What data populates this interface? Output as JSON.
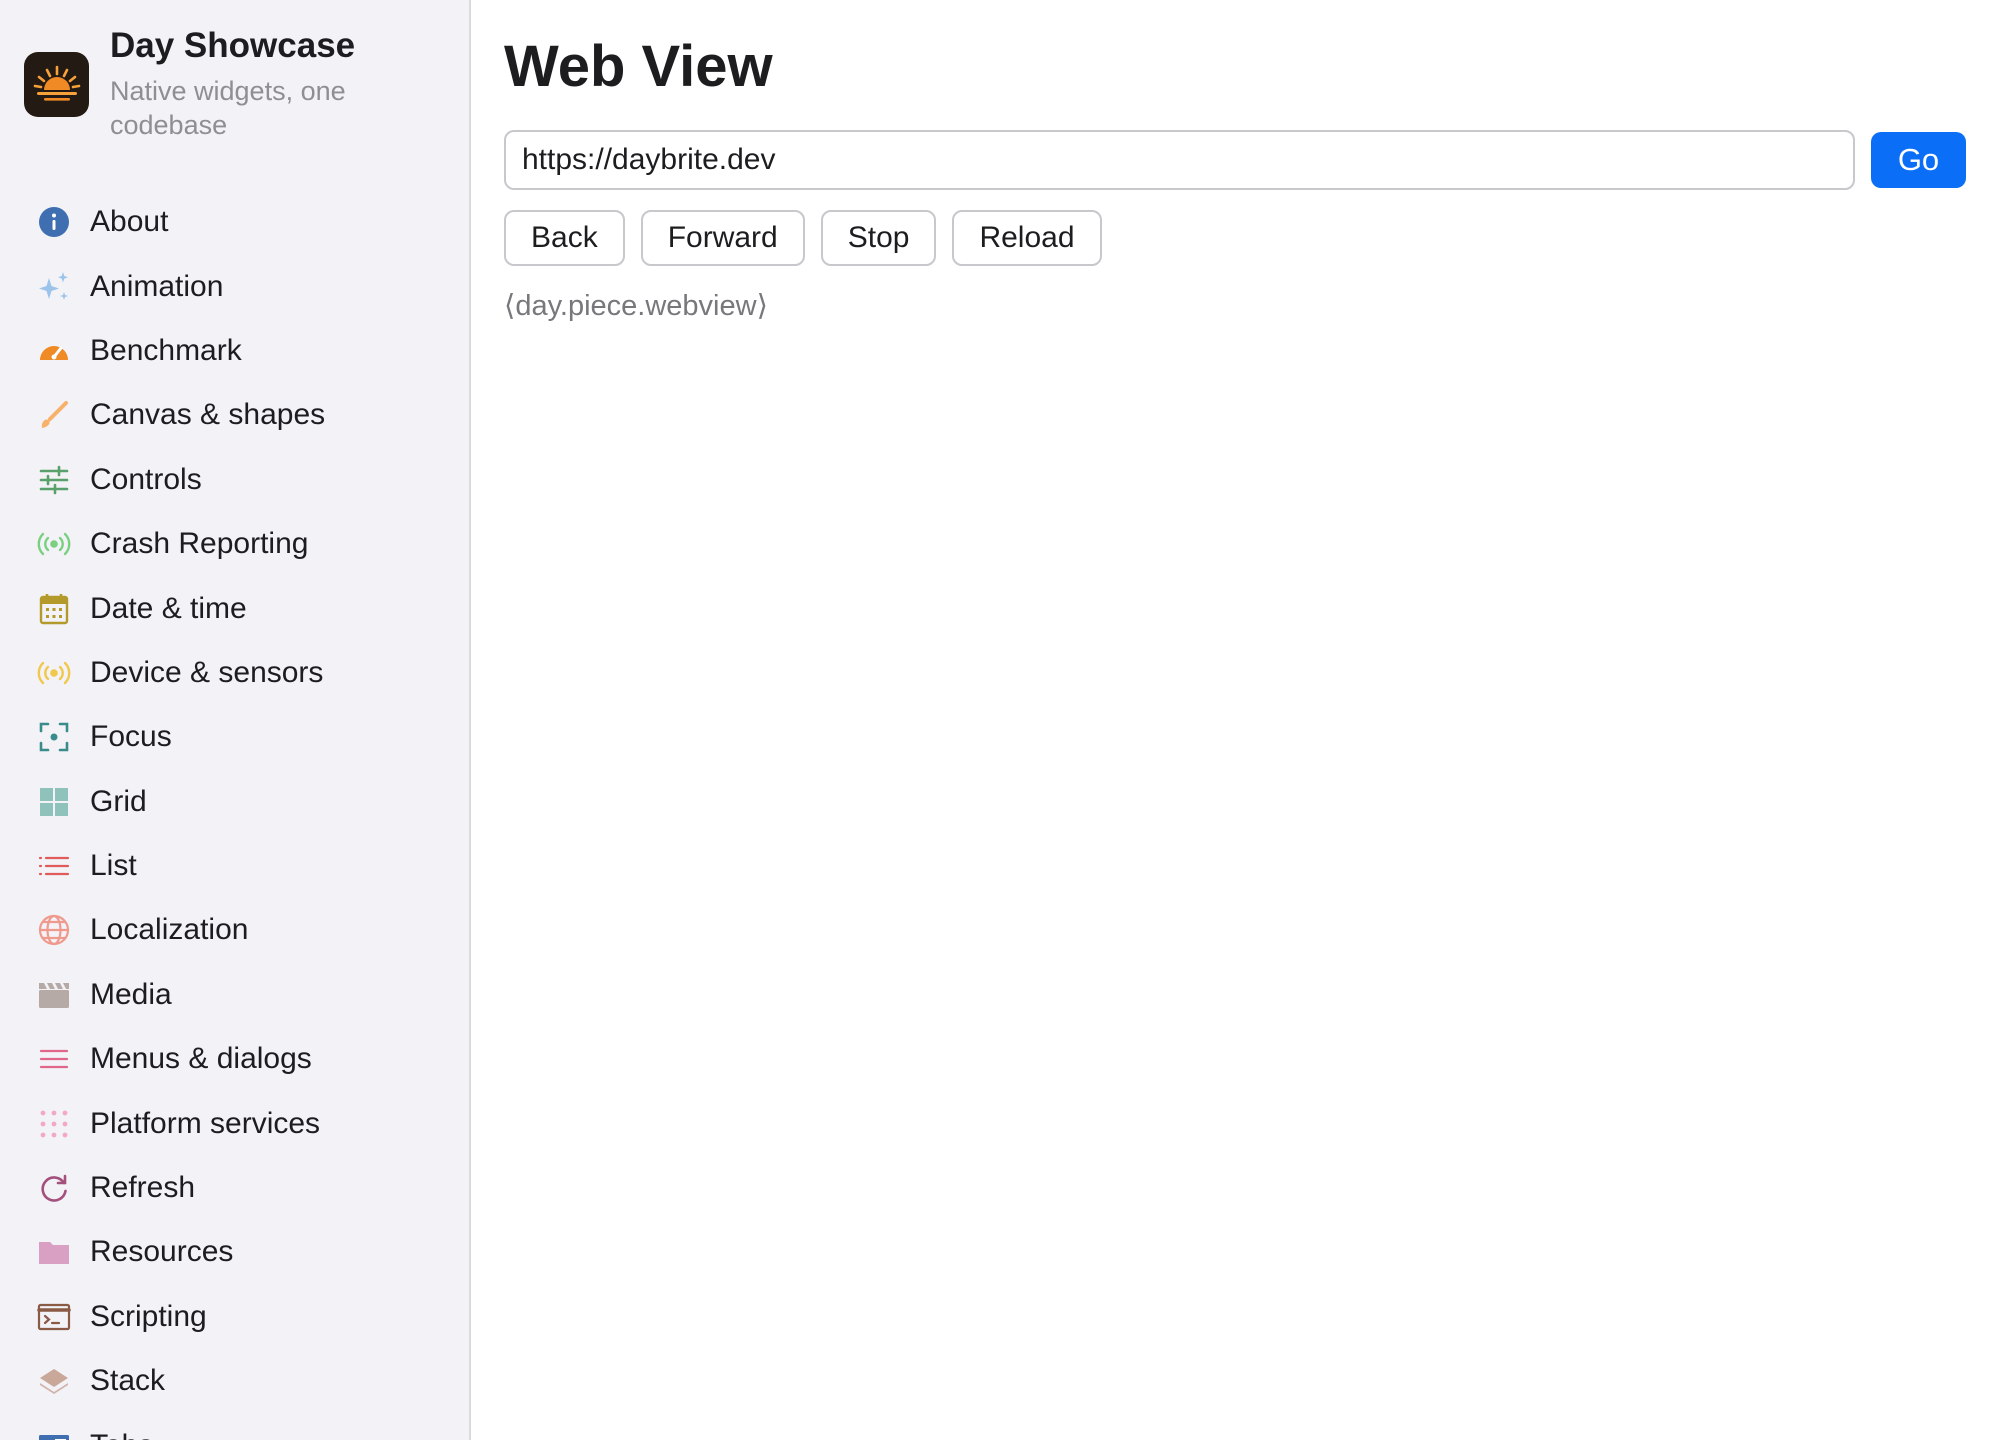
{
  "brand": {
    "title": "Day Showcase",
    "subtitle": "Native widgets, one codebase",
    "logo_icon": "sunrise-logo-icon"
  },
  "sidebar": {
    "items": [
      {
        "label": "About",
        "icon": "info-icon",
        "color": "#3f6fb0"
      },
      {
        "label": "Animation",
        "icon": "sparkles-icon",
        "color": "#9cc4ea"
      },
      {
        "label": "Benchmark",
        "icon": "speedometer-icon",
        "color": "#f08a24"
      },
      {
        "label": "Canvas & shapes",
        "icon": "paintbrush-icon",
        "color": "#f7b16a"
      },
      {
        "label": "Controls",
        "icon": "sliders-icon",
        "color": "#5aa06a"
      },
      {
        "label": "Crash Reporting",
        "icon": "broadcast-icon",
        "color": "#7bd080"
      },
      {
        "label": "Date & time",
        "icon": "calendar-icon",
        "color": "#b39a2a"
      },
      {
        "label": "Device & sensors",
        "icon": "broadcast-icon",
        "color": "#f2c84a"
      },
      {
        "label": "Focus",
        "icon": "focus-icon",
        "color": "#3a8c8c"
      },
      {
        "label": "Grid",
        "icon": "grid-icon",
        "color": "#8fc2bb"
      },
      {
        "label": "List",
        "icon": "list-icon",
        "color": "#e25b5b"
      },
      {
        "label": "Localization",
        "icon": "globe-icon",
        "color": "#f09a8e"
      },
      {
        "label": "Media",
        "icon": "film-icon",
        "color": "#b5aaa6"
      },
      {
        "label": "Menus & dialogs",
        "icon": "menu-icon",
        "color": "#e0678a"
      },
      {
        "label": "Platform services",
        "icon": "dots-grid-icon",
        "color": "#f4a9c2"
      },
      {
        "label": "Refresh",
        "icon": "refresh-icon",
        "color": "#a3507c"
      },
      {
        "label": "Resources",
        "icon": "folder-icon",
        "color": "#d9a0c4"
      },
      {
        "label": "Scripting",
        "icon": "terminal-icon",
        "color": "#8a5a45"
      },
      {
        "label": "Stack",
        "icon": "layers-icon",
        "color": "#c9a89a"
      },
      {
        "label": "Tabs",
        "icon": "tabs-icon",
        "color": "#3f6fb0"
      }
    ]
  },
  "main": {
    "title": "Web View",
    "url": "https://daybrite.dev",
    "go_label": "Go",
    "nav_buttons": [
      "Back",
      "Forward",
      "Stop",
      "Reload"
    ],
    "piece_text": "⟨day.piece.webview⟩"
  },
  "colors": {
    "accent": "#0b6ef7",
    "sidebar_bg": "#f2f2f7"
  }
}
